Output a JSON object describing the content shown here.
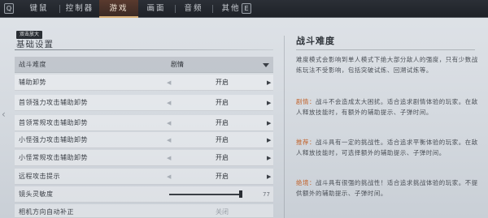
{
  "topbar": {
    "left_key": "Q",
    "right_key": "E",
    "tabs": [
      {
        "label": "键鼠",
        "active": false
      },
      {
        "label": "控制器",
        "active": false
      },
      {
        "label": "游戏",
        "active": true
      },
      {
        "label": "画面",
        "active": false
      },
      {
        "label": "音频",
        "active": false
      },
      {
        "label": "其他",
        "active": false
      }
    ]
  },
  "left": {
    "tooltip": "双击放大",
    "section_title": "基础设置",
    "dropdown": {
      "label": "战斗难度",
      "value": "剧情"
    },
    "toggles": [
      {
        "label": "辅助卸势",
        "value": "开启"
      },
      {
        "label": "首领强力攻击辅助卸势",
        "value": "开启"
      },
      {
        "label": "首领常规攻击辅助卸势",
        "value": "开启"
      },
      {
        "label": "小怪强力攻击辅助卸势",
        "value": "开启"
      },
      {
        "label": "小怪常规攻击辅助卸势",
        "value": "开启"
      },
      {
        "label": "远程攻击提示",
        "value": "开启"
      }
    ],
    "slider": {
      "label": "镜头灵敏度",
      "value": "77",
      "fraction": 0.98
    },
    "partial": {
      "label": "相机方向自动补正",
      "value": "关闭"
    }
  },
  "right": {
    "title": "战斗难度",
    "intro": "难度模式会影响到单人模式下绝大部分敌人的强度，只有少数战练玩法不受影响，包括突破试炼、回溯试炼等。",
    "entries": [
      {
        "tag": "剧情：",
        "text": "战斗不会造成太大困扰。适合追求剧情体验的玩家。在敌人释放技能时，有额外的辅助提示、子弹时间。"
      },
      {
        "tag": "推荐：",
        "text": "战斗具有一定的挑战性。适合追求平衡体验的玩家。在敌人释放技能时，可选择额外的辅助提示、子弹时间。"
      },
      {
        "tag": "绝境：",
        "text": "战斗具有很强的挑战性！适合追求挑战体验的玩家。不提供额外的辅助提示、子弹时间。"
      }
    ]
  },
  "colors": {
    "accent_tab": "#5a3a2e",
    "tag": "#c2622a"
  }
}
